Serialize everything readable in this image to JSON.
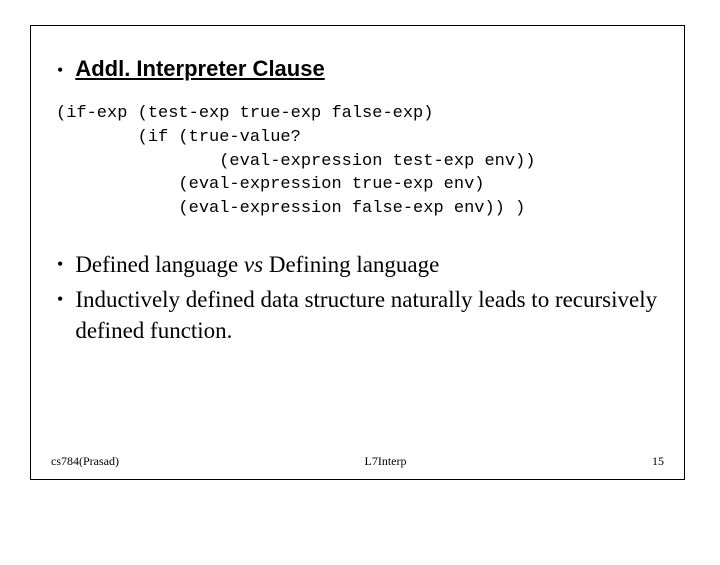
{
  "heading": "Addl. Interpreter Clause",
  "code": {
    "l1": "(if-exp (test-exp true-exp false-exp)",
    "l2": "        (if (true-value?",
    "l3": "                (eval-expression test-exp env))",
    "l4": "            (eval-expression true-exp env)",
    "l5": "            (eval-expression false-exp env)) )"
  },
  "bullets": {
    "b1_pre": "Defined language  ",
    "b1_vs": "vs",
    "b1_post": "   Defining language",
    "b2": "Inductively defined data structure naturally leads to recursively defined function."
  },
  "footer": {
    "left": "cs784(Prasad)",
    "center": "L7Interp",
    "right": "15"
  }
}
